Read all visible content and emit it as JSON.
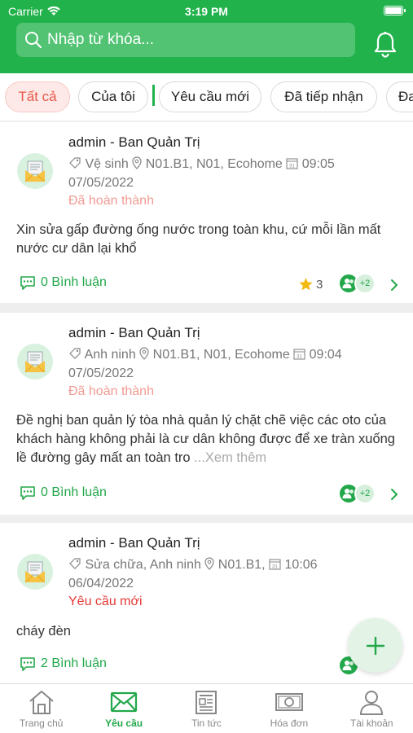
{
  "status_bar": {
    "carrier": "Carrier",
    "time": "3:19 PM"
  },
  "search": {
    "placeholder": "Nhập từ khóa..."
  },
  "tabs": [
    {
      "label": "Tất cả",
      "active": true
    },
    {
      "label": "Của tôi",
      "active": false
    },
    {
      "label": "Yêu cầu mới",
      "active": false
    },
    {
      "label": "Đã tiếp nhận",
      "active": false
    },
    {
      "label": "Đa",
      "active": false
    }
  ],
  "cards": [
    {
      "author": "admin - Ban Quản Trị",
      "category": "Vệ sinh",
      "location": "N01.B1, N01, Ecohome",
      "time": "09:05",
      "date": "07/05/2022",
      "status": "Đã hoàn thành",
      "content": "Xin sửa gấp đường ống nước trong toàn khu, cứ mỗi lần mất nước cư dân lại khổ",
      "more": "",
      "comments": "0 Bình luận",
      "rating": "3",
      "assignee_extra": "+2"
    },
    {
      "author": "admin - Ban Quản Trị",
      "category": "Anh ninh",
      "location": "N01.B1, N01, Ecohome",
      "time": "09:04",
      "date": "07/05/2022",
      "status": "Đã hoàn thành",
      "content": "Đề nghị ban quản lý tòa nhà quản lý chặt chẽ việc các oto của khách hàng không phải là cư dân không được để xe tràn xuống lề đường gây mất an toàn tro ",
      "more": "...Xem thêm",
      "comments": "0 Bình luận",
      "rating": "",
      "assignee_extra": "+2"
    },
    {
      "author": "admin - Ban Quản Trị",
      "category": "Sửa chữa, Anh ninh",
      "location": "N01.B1,",
      "time": "10:06",
      "date": "06/04/2022",
      "status": "Yêu cầu mới",
      "content": "cháy đèn",
      "more": "",
      "comments": "2 Bình luận",
      "rating": "",
      "assignee_extra": ""
    }
  ],
  "nav": [
    {
      "label": "Trang chủ",
      "icon": "home-icon"
    },
    {
      "label": "Yêu cầu",
      "icon": "mail-icon"
    },
    {
      "label": "Tin tức",
      "icon": "newspaper-icon"
    },
    {
      "label": "Hóa đơn",
      "icon": "money-icon"
    },
    {
      "label": "Tài khoản",
      "icon": "user-icon"
    }
  ],
  "colors": {
    "brand_green": "#22b24c",
    "status_done": "#f29b93",
    "status_new": "#e53935",
    "star": "#f2b90f"
  }
}
